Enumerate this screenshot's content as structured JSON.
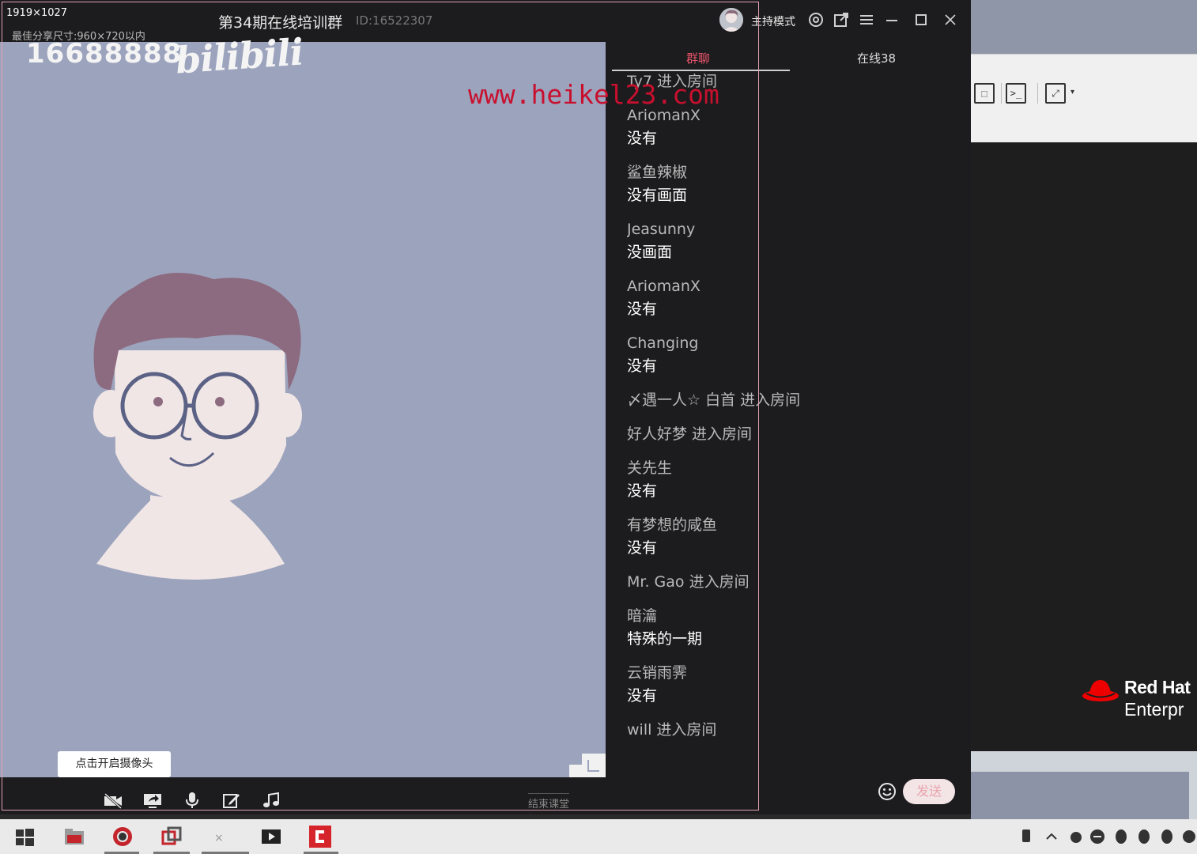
{
  "window": {
    "resolution_label": "1919×1027",
    "share_tip": "最佳分享尺寸:960×720以内",
    "room_title": "第34期在线培训群",
    "room_id": "ID:16522307",
    "host_mode_label": "主持模式"
  },
  "watermarks": {
    "number": "16688888",
    "logo": "bilibili",
    "url": "www.heikel23.com"
  },
  "chat": {
    "tabs": [
      {
        "label": "群聊",
        "active": true
      },
      {
        "label": "在线38",
        "active": false
      }
    ],
    "messages": [
      {
        "sender": "Ty7 进入房间",
        "text": ""
      },
      {
        "sender": "AriomanX",
        "text": "没有"
      },
      {
        "sender": "鲨鱼辣椒",
        "text": "没有画面"
      },
      {
        "sender": "Jeasunny",
        "text": "没画面"
      },
      {
        "sender": "AriomanX",
        "text": "没有"
      },
      {
        "sender": "Changing",
        "text": "没有"
      },
      {
        "sender": "〆遇一人☆ 白首 进入房间",
        "text": ""
      },
      {
        "sender": "好人好梦 进入房间",
        "text": ""
      },
      {
        "sender": "关先生",
        "text": "没有"
      },
      {
        "sender": "有梦想的咸鱼",
        "text": "没有"
      },
      {
        "sender": "Mr. Gao 进入房间",
        "text": ""
      },
      {
        "sender": "暗瀹",
        "text": "特殊的一期"
      },
      {
        "sender": "云销雨霁",
        "text": "没有"
      },
      {
        "sender": "will 进入房间",
        "text": ""
      }
    ],
    "send_label": "发送"
  },
  "video": {
    "camera_tip": "点击开启摄像头",
    "end_class_label": "结束课堂"
  },
  "background_app": {
    "brand_name": "Red Hat",
    "brand_sub": "Enterpr"
  },
  "colors": {
    "accent": "#e8546a",
    "video_bg": "#9ca3bd",
    "panel_bg": "#1c1c1e",
    "watermark_red": "#c8102e"
  }
}
